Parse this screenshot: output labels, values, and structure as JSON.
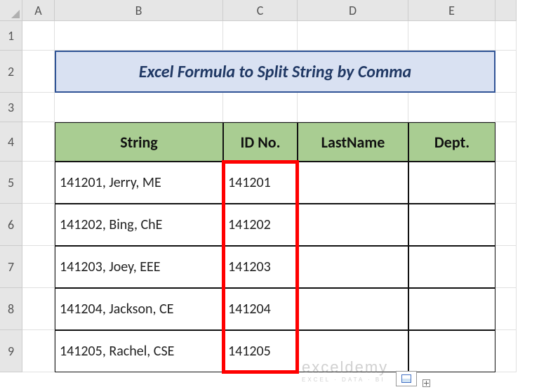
{
  "columns": [
    "A",
    "B",
    "C",
    "D",
    "E"
  ],
  "rows": [
    "1",
    "2",
    "3",
    "4",
    "5",
    "6",
    "7",
    "8",
    "9"
  ],
  "title": "Excel Formula to Split String by Comma",
  "headers": {
    "B": "String",
    "C": "ID No.",
    "D": "LastName",
    "E": "Dept."
  },
  "data": [
    {
      "B": "141201, Jerry, ME",
      "C": "141201",
      "D": "",
      "E": ""
    },
    {
      "B": "141202, Bing, ChE",
      "C": "141202",
      "D": "",
      "E": ""
    },
    {
      "B": "141203, Joey, EEE",
      "C": "141203",
      "D": "",
      "E": ""
    },
    {
      "B": "141204, Jackson, CE",
      "C": "141204",
      "D": "",
      "E": ""
    },
    {
      "B": "141205, Rachel, CSE",
      "C": "141205",
      "D": "",
      "E": ""
    }
  ],
  "watermark": {
    "brand": "exceldemy",
    "tag": "EXCEL · DATA · BI"
  },
  "chart_data": {
    "type": "table",
    "title": "Excel Formula to Split String by Comma",
    "columns": [
      "String",
      "ID No.",
      "LastName",
      "Dept."
    ],
    "rows": [
      [
        "141201, Jerry, ME",
        "141201",
        "",
        ""
      ],
      [
        "141202, Bing, ChE",
        "141202",
        "",
        ""
      ],
      [
        "141203, Joey, EEE",
        "141203",
        "",
        ""
      ],
      [
        "141204, Jackson, CE",
        "141204",
        "",
        ""
      ],
      [
        "141205, Rachel, CSE",
        "141205",
        "",
        ""
      ]
    ]
  }
}
